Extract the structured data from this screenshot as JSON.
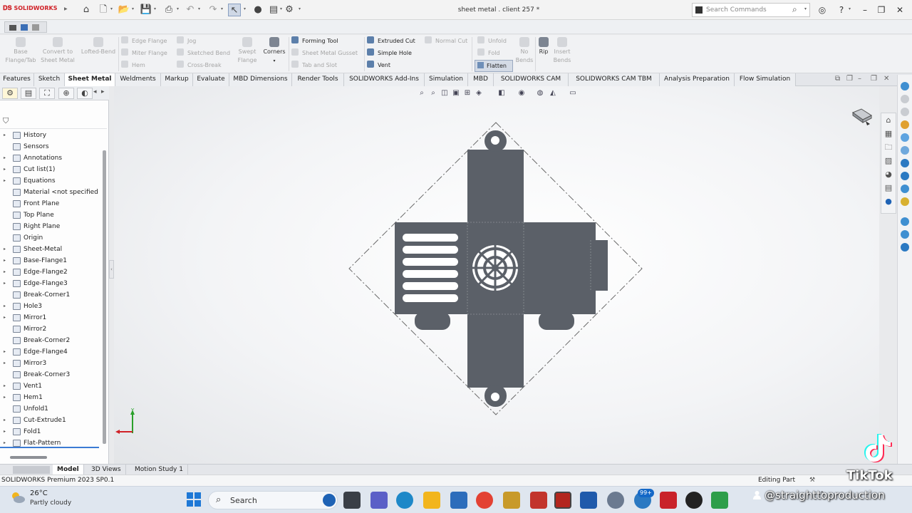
{
  "app": {
    "brand": "SOLIDWORKS",
    "doc_title": "sheet metal . client 257 *",
    "search_placeholder": "Search Commands"
  },
  "titlebar_icons": [
    "home-icon",
    "new-file-icon",
    "open-file-icon",
    "save-icon",
    "print-icon",
    "undo-icon",
    "redo-icon",
    "select-arrow-icon",
    "rebuild-icon",
    "file-properties-icon",
    "options-gear-icon"
  ],
  "command_manager": {
    "big_buttons": [
      {
        "label": "Base\nFlange/Tab",
        "enabled": false
      },
      {
        "label": "Convert to\nSheet Metal",
        "enabled": false
      },
      {
        "label": "Lofted-Bend",
        "enabled": false
      },
      {
        "label": "Swept\nFlange",
        "enabled": false
      },
      {
        "label": "Corners",
        "enabled": true
      },
      {
        "label": "Rip",
        "enabled": true
      },
      {
        "label": "No\nBends",
        "enabled": false
      },
      {
        "label": "Insert\nBends",
        "enabled": false
      }
    ],
    "small_buttons": [
      {
        "label": "Edge Flange",
        "enabled": false
      },
      {
        "label": "Miter Flange",
        "enabled": false
      },
      {
        "label": "Hem",
        "enabled": false
      },
      {
        "label": "Jog",
        "enabled": false
      },
      {
        "label": "Sketched Bend",
        "enabled": false
      },
      {
        "label": "Cross-Break",
        "enabled": false
      },
      {
        "label": "Forming Tool",
        "enabled": true
      },
      {
        "label": "Sheet Metal Gusset",
        "enabled": false
      },
      {
        "label": "Tab and Slot",
        "enabled": false
      },
      {
        "label": "Extruded Cut",
        "enabled": true
      },
      {
        "label": "Simple Hole",
        "enabled": true
      },
      {
        "label": "Vent",
        "enabled": true
      },
      {
        "label": "Normal Cut",
        "enabled": false
      },
      {
        "label": "Unfold",
        "enabled": false
      },
      {
        "label": "Fold",
        "enabled": false
      }
    ],
    "flatten_label": "Flatten"
  },
  "tabs": [
    {
      "label": "Features",
      "active": false
    },
    {
      "label": "Sketch",
      "active": false
    },
    {
      "label": "Sheet Metal",
      "active": true
    },
    {
      "label": "Weldments",
      "active": false
    },
    {
      "label": "Markup",
      "active": false
    },
    {
      "label": "Evaluate",
      "active": false
    },
    {
      "label": "MBD Dimensions",
      "active": false
    },
    {
      "label": "Render Tools",
      "active": false
    },
    {
      "label": "SOLIDWORKS Add-Ins",
      "active": false
    },
    {
      "label": "Simulation",
      "active": false
    },
    {
      "label": "MBD",
      "active": false
    },
    {
      "label": "SOLIDWORKS CAM",
      "active": false
    },
    {
      "label": "SOLIDWORKS CAM TBM",
      "active": false
    },
    {
      "label": "Analysis Preparation",
      "active": false
    },
    {
      "label": "Flow Simulation",
      "active": false
    }
  ],
  "feature_tree": [
    {
      "label": "History",
      "expandable": true,
      "icon": "history-icon"
    },
    {
      "label": "Sensors",
      "expandable": false,
      "icon": "sensors-icon"
    },
    {
      "label": "Annotations",
      "expandable": true,
      "icon": "annotations-icon"
    },
    {
      "label": "Cut list(1)",
      "expandable": true,
      "icon": "cut-list-icon"
    },
    {
      "label": "Equations",
      "expandable": true,
      "icon": "equations-icon"
    },
    {
      "label": "Material <not specified",
      "expandable": false,
      "icon": "material-icon"
    },
    {
      "label": "Front Plane",
      "expandable": false,
      "icon": "plane-icon"
    },
    {
      "label": "Top Plane",
      "expandable": false,
      "icon": "plane-icon"
    },
    {
      "label": "Right Plane",
      "expandable": false,
      "icon": "plane-icon"
    },
    {
      "label": "Origin",
      "expandable": false,
      "icon": "origin-icon"
    },
    {
      "label": "Sheet-Metal",
      "expandable": true,
      "icon": "sheet-metal-icon"
    },
    {
      "label": "Base-Flange1",
      "expandable": true,
      "icon": "base-flange-icon"
    },
    {
      "label": "Edge-Flange2",
      "expandable": true,
      "icon": "edge-flange-icon"
    },
    {
      "label": "Edge-Flange3",
      "expandable": true,
      "icon": "edge-flange-icon"
    },
    {
      "label": "Break-Corner1",
      "expandable": false,
      "icon": "break-corner-icon"
    },
    {
      "label": "Hole3",
      "expandable": true,
      "icon": "hole-icon"
    },
    {
      "label": "Mirror1",
      "expandable": true,
      "icon": "mirror-icon"
    },
    {
      "label": "Mirror2",
      "expandable": false,
      "icon": "mirror-icon"
    },
    {
      "label": "Break-Corner2",
      "expandable": false,
      "icon": "break-corner-icon"
    },
    {
      "label": "Edge-Flange4",
      "expandable": true,
      "icon": "edge-flange-icon"
    },
    {
      "label": "Mirror3",
      "expandable": true,
      "icon": "mirror-icon"
    },
    {
      "label": "Break-Corner3",
      "expandable": false,
      "icon": "break-corner-icon"
    },
    {
      "label": "Vent1",
      "expandable": true,
      "icon": "vent-icon"
    },
    {
      "label": "Hem1",
      "expandable": true,
      "icon": "hem-icon"
    },
    {
      "label": "Unfold1",
      "expandable": false,
      "icon": "unfold-icon"
    },
    {
      "label": "Cut-Extrude1",
      "expandable": true,
      "icon": "cut-extrude-icon"
    },
    {
      "label": "Fold1",
      "expandable": true,
      "icon": "fold-icon"
    },
    {
      "label": "Flat-Pattern",
      "expandable": true,
      "icon": "flat-pattern-icon"
    }
  ],
  "model_tabs": [
    {
      "label": "Model",
      "active": true
    },
    {
      "label": "3D Views",
      "active": false
    },
    {
      "label": "Motion Study 1",
      "active": false
    }
  ],
  "status": {
    "product": "SOLIDWORKS Premium 2023 SP0.1",
    "mode": "Editing Part"
  },
  "taskbar": {
    "temperature": "26°C",
    "weather": "Partly cloudy",
    "search_label": "Search",
    "notification_badge": "99+"
  },
  "overlay": {
    "platform": "TikTok",
    "username": "@straighttoproduction"
  },
  "colors": {
    "part": "#5b6068",
    "accent": "#3b7bd4",
    "brand_red": "#d02127"
  }
}
